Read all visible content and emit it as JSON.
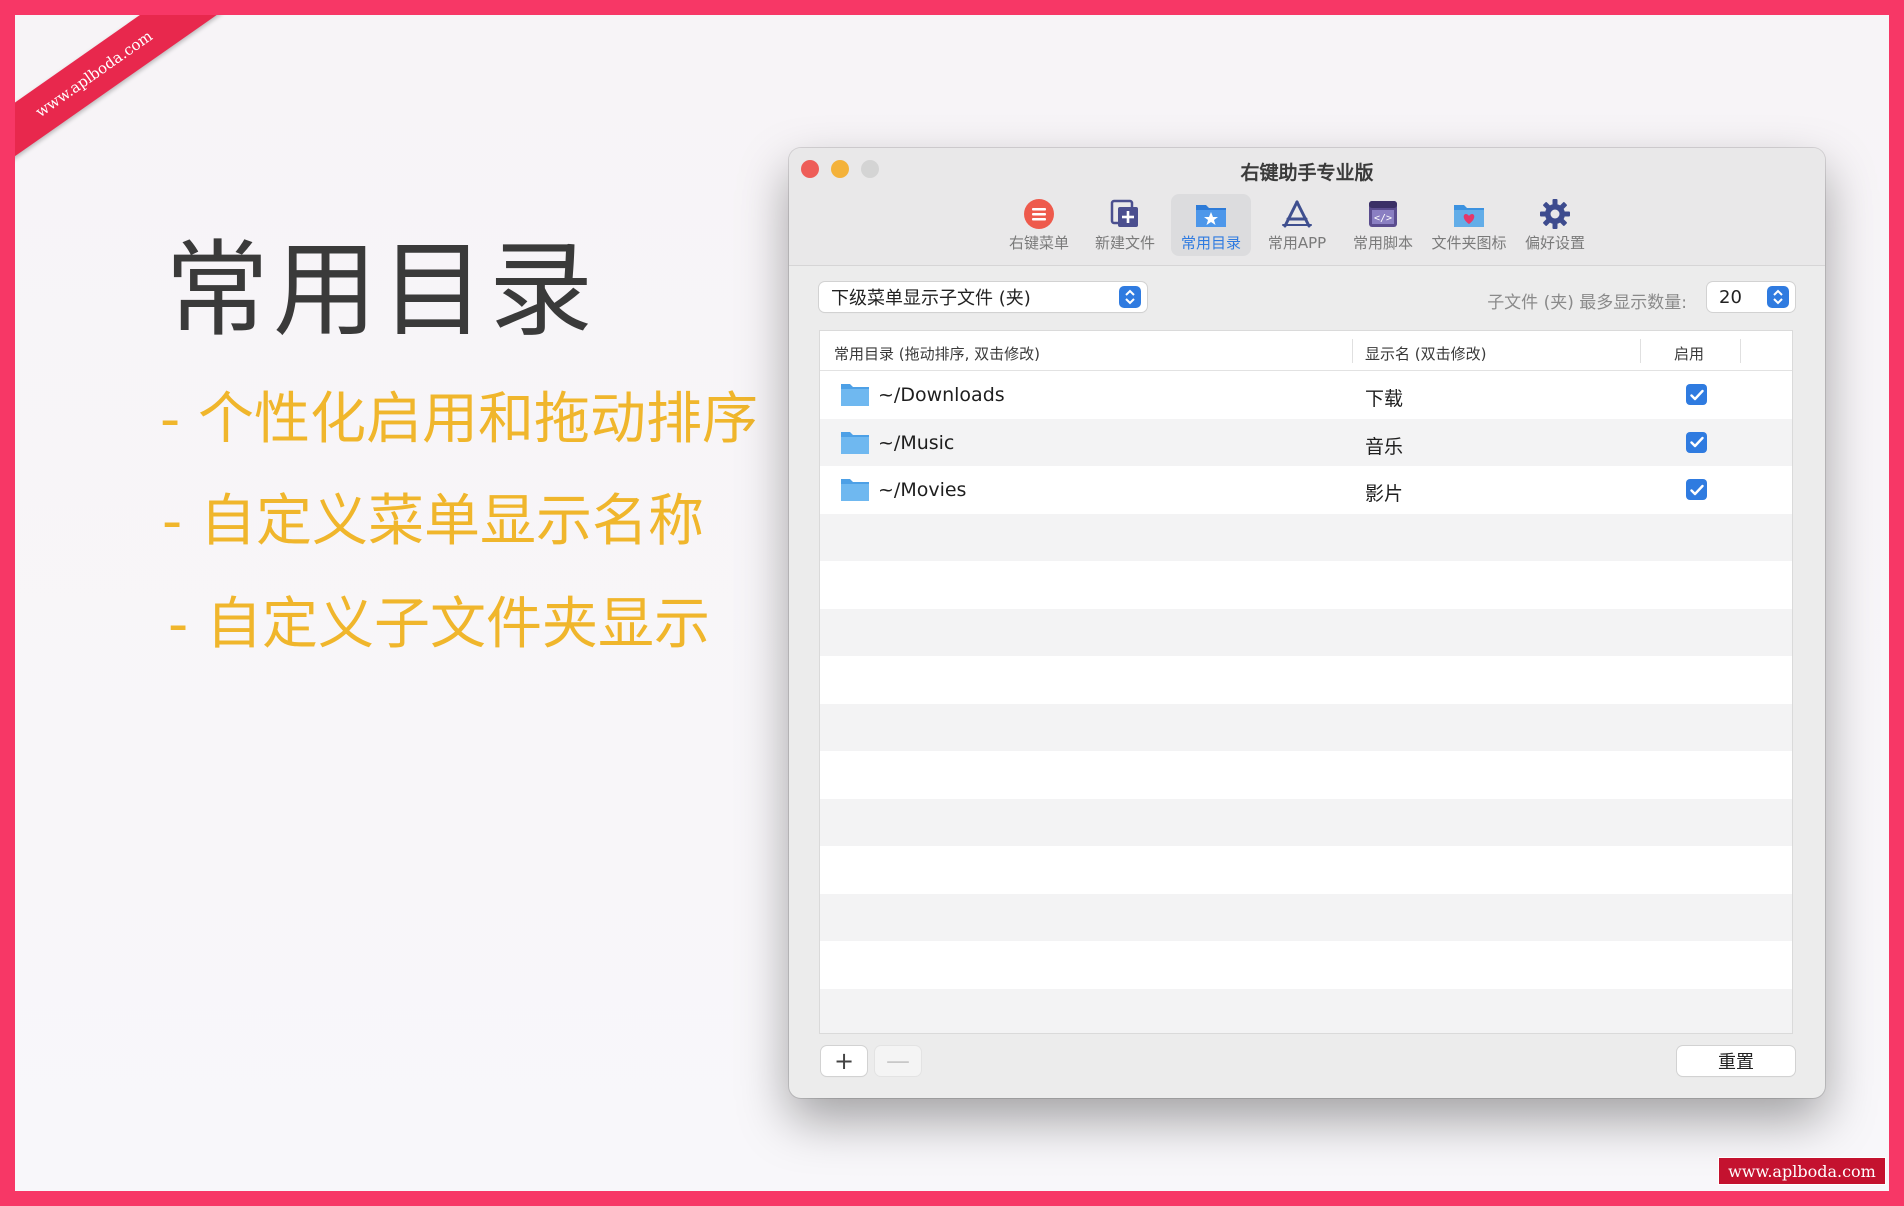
{
  "watermark": {
    "ribbon": "www.aplboda.com",
    "corner": "www.aplboda.com"
  },
  "promo": {
    "headline": "常用目录",
    "features": [
      "- 个性化启用和拖动排序",
      "- 自定义菜单显示名称",
      "- 自定义子文件夹显示"
    ]
  },
  "window": {
    "title": "右键助手专业版",
    "toolbar": [
      {
        "label": "右键菜单",
        "icon": "menu-icon"
      },
      {
        "label": "新建文件",
        "icon": "new-file-icon"
      },
      {
        "label": "常用目录",
        "icon": "favorite-folder-icon",
        "active": true
      },
      {
        "label": "常用APP",
        "icon": "app-store-icon"
      },
      {
        "label": "常用脚本",
        "icon": "script-icon"
      },
      {
        "label": "文件夹图标",
        "icon": "folder-icon-icon"
      },
      {
        "label": "偏好设置",
        "icon": "gear-icon"
      }
    ],
    "submenu_select": "下级菜单显示子文件 (夹)",
    "max_count_label": "子文件 (夹) 最多显示数量:",
    "max_count_value": "20",
    "table": {
      "headers": [
        "常用目录 (拖动排序, 双击修改)",
        "显示名 (双击修改)",
        "启用"
      ],
      "rows": [
        {
          "path": "~/Downloads",
          "name": "下载",
          "enabled": true
        },
        {
          "path": "~/Music",
          "name": "音乐",
          "enabled": true
        },
        {
          "path": "~/Movies",
          "name": "影片",
          "enabled": true
        }
      ]
    },
    "buttons": {
      "add": "+",
      "remove": "—",
      "reset": "重置"
    }
  },
  "colors": {
    "frame": "#f73766",
    "accent": "#2f7be0",
    "feature_text": "#f0b62c"
  }
}
